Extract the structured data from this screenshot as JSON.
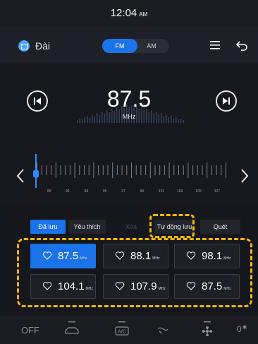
{
  "status": {
    "time": "12:04",
    "ampm": "AM"
  },
  "header": {
    "title": "Đài",
    "band_fm": "FM",
    "band_am": "AM"
  },
  "tuner": {
    "frequency": "87.5",
    "unit": "MHz"
  },
  "scale": {
    "ticks": [
      "89",
      "91",
      "93",
      "95",
      "97",
      "99",
      "101",
      "103",
      "105",
      "107"
    ]
  },
  "tabs": {
    "saved": "Đã lưu",
    "favorites": "Yêu thích",
    "delete": "Xóa",
    "auto_save": "Tự động lưu",
    "scan": "Quét"
  },
  "presets": [
    {
      "freq": "87.5",
      "unit": "MHz",
      "active": true
    },
    {
      "freq": "88.1",
      "unit": "MHz",
      "active": false
    },
    {
      "freq": "98.1",
      "unit": "MHz",
      "active": false
    },
    {
      "freq": "104.1",
      "unit": "MHz",
      "active": false
    },
    {
      "freq": "107.9",
      "unit": "MHz",
      "active": false
    },
    {
      "freq": "87.5",
      "unit": "MHz",
      "active": false
    }
  ],
  "climate": {
    "off_label": "OFF",
    "ac_label": "A/C",
    "fan_value": "0"
  },
  "colors": {
    "accent": "#1a73e8",
    "highlight": "#f5b700",
    "background": "#15171d"
  }
}
